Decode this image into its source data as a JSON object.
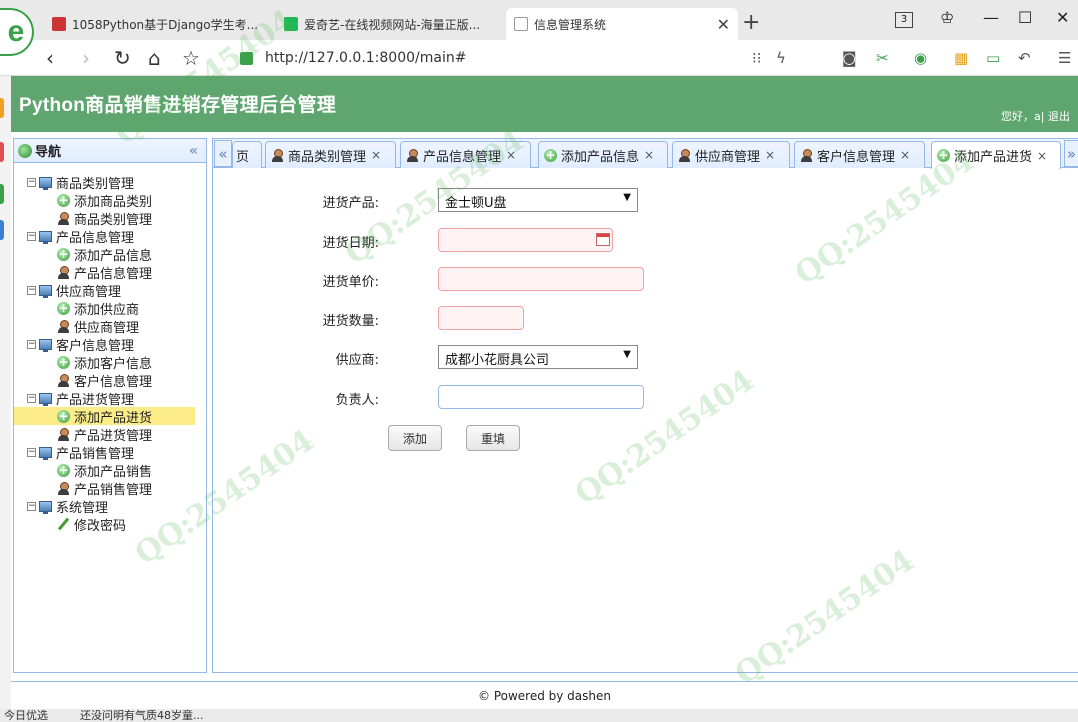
{
  "browser": {
    "tabs": [
      {
        "label": "1058Python基于Django学生考..."
      },
      {
        "label": "爱奇艺-在线视频网站-海量正版..."
      },
      {
        "label": "信息管理系统"
      }
    ],
    "tab_count": "3",
    "url": "http://127.0.0.1:8000/main#",
    "new_tab": "+"
  },
  "header": {
    "title": "Python商品销售进销存管理后台管理",
    "greeting": "您好，a",
    "separator": "|",
    "logout": "退出"
  },
  "nav": {
    "title": "导航",
    "collapse": "«",
    "groups": [
      {
        "label": "商品类别管理",
        "items": [
          {
            "label": "添加商品类别",
            "icon": "add-icon"
          },
          {
            "label": "商品类别管理",
            "icon": "user-icon"
          }
        ]
      },
      {
        "label": "产品信息管理",
        "items": [
          {
            "label": "添加产品信息",
            "icon": "add-icon"
          },
          {
            "label": "产品信息管理",
            "icon": "user-icon"
          }
        ]
      },
      {
        "label": "供应商管理",
        "items": [
          {
            "label": "添加供应商",
            "icon": "add-icon"
          },
          {
            "label": "供应商管理",
            "icon": "user-icon"
          }
        ]
      },
      {
        "label": "客户信息管理",
        "items": [
          {
            "label": "添加客户信息",
            "icon": "add-icon"
          },
          {
            "label": "客户信息管理",
            "icon": "user-icon"
          }
        ]
      },
      {
        "label": "产品进货管理",
        "items": [
          {
            "label": "添加产品进货",
            "icon": "add-icon"
          },
          {
            "label": "产品进货管理",
            "icon": "user-icon"
          }
        ]
      },
      {
        "label": "产品销售管理",
        "items": [
          {
            "label": "添加产品销售",
            "icon": "add-icon"
          },
          {
            "label": "产品销售管理",
            "icon": "user-icon"
          }
        ]
      },
      {
        "label": "系统管理",
        "items": [
          {
            "label": "修改密码",
            "icon": "pencil-icon"
          }
        ]
      }
    ]
  },
  "tabs": {
    "scroll_left": "«",
    "scroll_right": "»",
    "items": [
      {
        "label": "页",
        "icon": "none",
        "closable": false
      },
      {
        "label": "商品类别管理",
        "icon": "user-icon",
        "closable": true
      },
      {
        "label": "产品信息管理",
        "icon": "user-icon",
        "closable": true
      },
      {
        "label": "添加产品信息",
        "icon": "add-icon",
        "closable": true
      },
      {
        "label": "供应商管理",
        "icon": "user-icon",
        "closable": true
      },
      {
        "label": "客户信息管理",
        "icon": "user-icon",
        "closable": true
      },
      {
        "label": "添加产品进货",
        "icon": "add-icon",
        "closable": true,
        "active": true
      }
    ],
    "close_glyph": "×"
  },
  "form": {
    "product": {
      "label": "进货产品:",
      "value": "金士顿U盘"
    },
    "date": {
      "label": "进货日期:",
      "value": ""
    },
    "price": {
      "label": "进货单价:",
      "value": ""
    },
    "quantity": {
      "label": "进货数量:",
      "value": ""
    },
    "supplier": {
      "label": "供应商:",
      "value": "成都小花厨具公司"
    },
    "owner": {
      "label": "负责人:",
      "value": ""
    },
    "submit": "添加",
    "reset": "重填",
    "select_arrow": "▼"
  },
  "footer": {
    "text": "© Powered by dashen"
  },
  "statusbar": {
    "left": "今日优选",
    "news": "还没问明有气质48岁童..."
  },
  "colors": {
    "header_green": "#5fa56f",
    "panel_border": "#95b8e7",
    "selected_row": "#fbec88"
  }
}
